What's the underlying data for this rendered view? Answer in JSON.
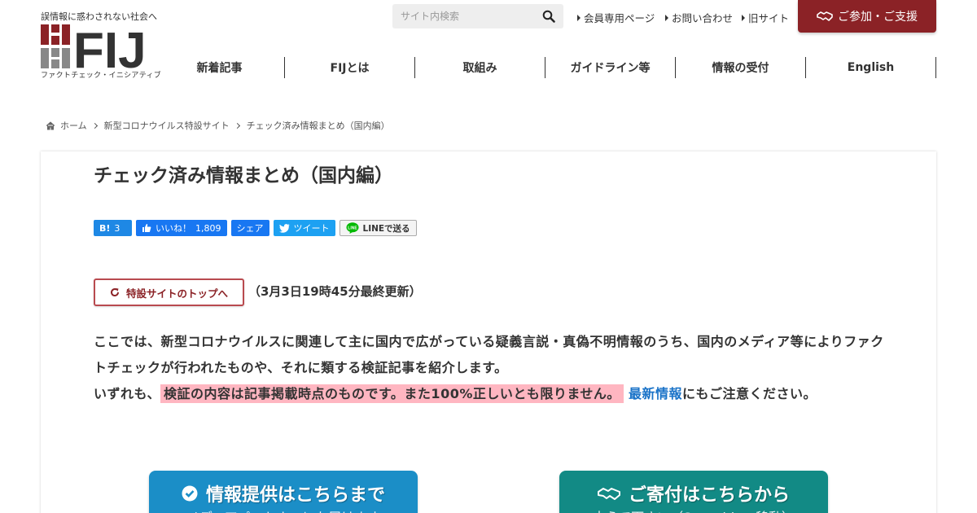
{
  "header": {
    "tagline": "誤情報に惑わされない社会へ",
    "logo_text": "FIJ",
    "logo_subtitle": "ファクトチェック・イニシアティブ",
    "search_placeholder": "サイト内検索",
    "top_links": [
      "会員専用ページ",
      "お問い合わせ",
      "旧サイト"
    ],
    "support_button": "ご参加・ご支援",
    "brand_color": "#8b2226"
  },
  "nav": {
    "items": [
      "新着記事",
      "FIJとは",
      "取組み",
      "ガイドライン等",
      "情報の受付",
      "English"
    ]
  },
  "breadcrumb": {
    "items": [
      "ホーム",
      "新型コロナウイルス特設サイト",
      "チェック済み情報まとめ（国内編）"
    ]
  },
  "main": {
    "title": "チェック済み情報まとめ（国内編）",
    "share": {
      "hatena_label": "B!",
      "hatena_count": "3",
      "fb_like_label": "いいね！",
      "fb_like_count": "1,809",
      "fb_share_label": "シェア",
      "tweet_label": "ツイート",
      "line_label": "LINEで送る"
    },
    "top_button": "特設サイトのトップへ",
    "updated": "（3月3日19時45分最終更新）",
    "intro_line1": "ここでは、新型コロナウイルスに関連して主に国内で広がっている疑義言説・真偽不明情報のうち、国内のメディア等によりファクトチェックが行われたものや、それに類する検証記事を紹介します。",
    "intro_prefix": "いずれも、",
    "intro_highlight": "検証の内容は記事掲載時点のものです。また100%正しいとも限りません。",
    "intro_link": "最新情報",
    "intro_suffix": "にもご注意ください。"
  },
  "cta": {
    "info": {
      "title": "情報提供はこちらまで",
      "subtitle": "メディアパートナーにも届けます",
      "color": "#1b8ec7"
    },
    "donate": {
      "title": "ご寄付はこちらから",
      "subtitle": "支えて下さい（Syncableへ移動）",
      "color": "#128a85"
    }
  }
}
